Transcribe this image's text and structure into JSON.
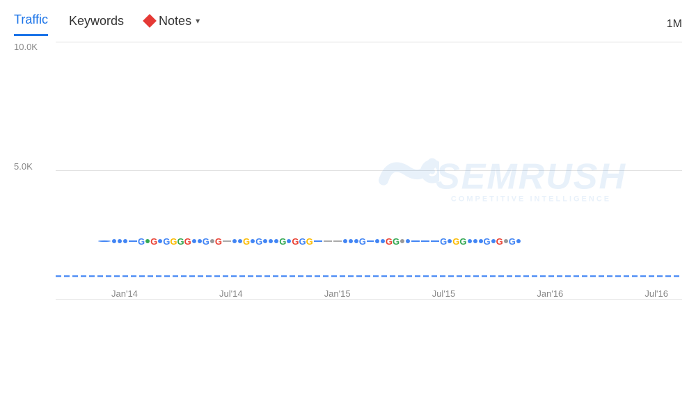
{
  "tabs": {
    "traffic": "Traffic",
    "keywords": "Keywords",
    "notes": "Notes",
    "active": "traffic"
  },
  "legend": {
    "diamond_color": "#e53935"
  },
  "right_value": "1M",
  "y_axis": {
    "top": "10.0K",
    "middle": "5.0K",
    "bottom": ""
  },
  "x_axis": {
    "labels": [
      "Jan'14",
      "Jul'14",
      "Jan'15",
      "Jul'15",
      "Jan'16",
      "Jul'16"
    ]
  },
  "watermark": {
    "logo": "SEMRUSH",
    "sub": "COMPETITIVE INTELLIGENCE"
  }
}
